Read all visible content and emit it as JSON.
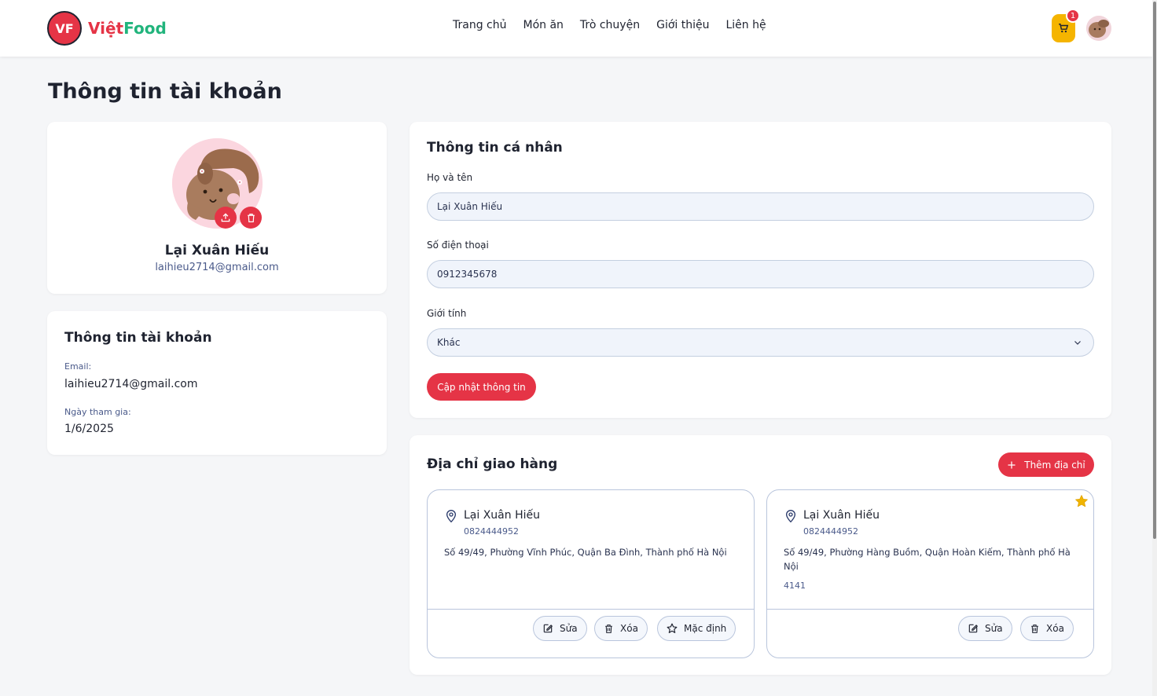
{
  "brand": {
    "logo_initials": "VF",
    "name_part1": "Việt",
    "name_part2": "Food",
    "primary_color": "#e53446",
    "secondary_color": "#21b47c"
  },
  "nav": {
    "items": [
      "Trang chủ",
      "Món ăn",
      "Trò chuyện",
      "Giới thiệu",
      "Liên hệ"
    ]
  },
  "header": {
    "cart_count": "1",
    "cart_icon": "cart-icon",
    "avatar_icon": "user-avatar"
  },
  "page": {
    "title": "Thông tin tài khoản"
  },
  "profile": {
    "name": "Lại Xuân Hiếu",
    "email": "laihieu2714@gmail.com",
    "upload_icon": "upload-icon",
    "delete_icon": "trash-icon"
  },
  "account": {
    "title": "Thông tin tài khoản",
    "email_label": "Email:",
    "email_value": "laihieu2714@gmail.com",
    "joined_label": "Ngày tham gia:",
    "joined_value": "1/6/2025"
  },
  "personal": {
    "title": "Thông tin cá nhân",
    "fullname_label": "Họ và tên",
    "fullname_value": "Lại Xuân Hiếu",
    "phone_label": "Số điện thoại",
    "phone_value": "0912345678",
    "gender_label": "Giới tính",
    "gender_value": "Khác",
    "update_button": "Cập nhật thông tin"
  },
  "addresses": {
    "title": "Địa chỉ giao hàng",
    "add_button": "Thêm địa chỉ",
    "edit_label": "Sửa",
    "delete_label": "Xóa",
    "default_label": "Mặc định",
    "items": [
      {
        "name": "Lại Xuân Hiếu",
        "phone": "0824444952",
        "address": "Số 49/49, Phường Vĩnh Phúc, Quận Ba Đình, Thành phố Hà Nội",
        "note": "",
        "is_default": false
      },
      {
        "name": "Lại Xuân Hiếu",
        "phone": "0824444952",
        "address": "Số 49/49, Phường Hàng Buồm, Quận Hoàn Kiếm, Thành phố Hà Nội",
        "note": "4141",
        "is_default": true
      }
    ]
  }
}
